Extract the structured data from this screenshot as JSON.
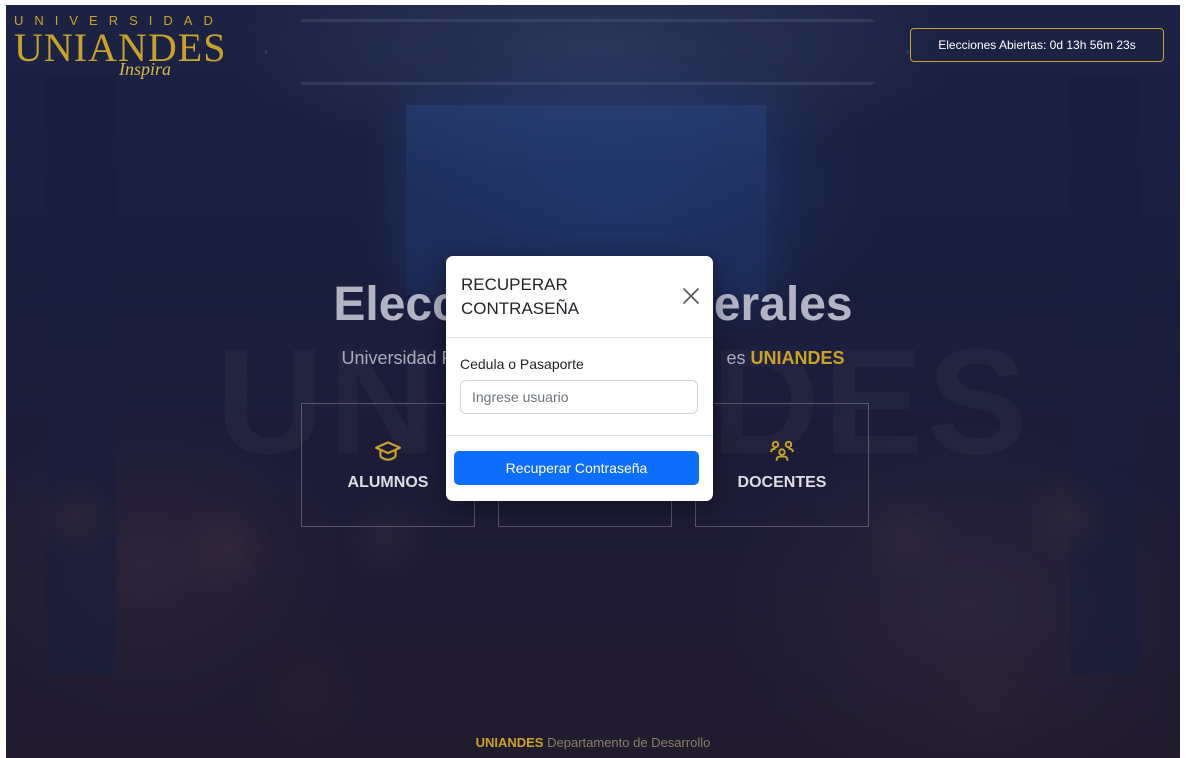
{
  "brand": {
    "logo_top": "UNIVERSIDAD",
    "logo_main": "UNIANDES",
    "logo_script": "Inspira",
    "accent_color": "#c9a227"
  },
  "header": {
    "timer_text": "Elecciones Abiertas: 0d 13h 56m 23s"
  },
  "hero": {
    "title_left": "Elecc",
    "title_right": "erales",
    "subtitle_left": "Universidad Re",
    "subtitle_right": "es ",
    "subtitle_brand": "UNIANDES",
    "watermark_text": "UNIANDES"
  },
  "cards": [
    {
      "label": "ALUMNOS",
      "icon": "graduation-cap-icon"
    },
    {
      "label": "",
      "icon": ""
    },
    {
      "label": "DOCENTES",
      "icon": "users-icon"
    }
  ],
  "footer": {
    "brand": "UNIANDES",
    "text": "Departamento de Desarrollo"
  },
  "modal": {
    "title": "RECUPERAR CONTRASEÑA",
    "close_icon": "close-icon",
    "field_label": "Cedula o Pasaporte",
    "field_placeholder": "Ingrese usuario",
    "field_value": "",
    "submit_label": "Recuperar Contraseña",
    "submit_color": "#0d6efd"
  }
}
